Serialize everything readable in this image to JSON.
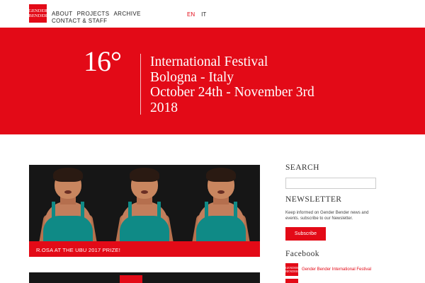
{
  "logo": {
    "line1": "GENDER",
    "line2": "BENDER"
  },
  "nav": {
    "items": [
      "ABOUT",
      "PROJECTS",
      "ARCHIVE",
      "CONTACT & STAFF"
    ]
  },
  "lang": {
    "active": "EN",
    "inactive": "IT"
  },
  "hero": {
    "edition": "16°",
    "line1": "International Festival",
    "line2": "Bologna - Italy",
    "line3": "October 24th - November 3rd",
    "line4": "2018"
  },
  "feature": {
    "caption": "R.OSA AT THE UBU 2017 PRIZE!"
  },
  "sidebar": {
    "search_heading": "SEARCH",
    "newsletter_heading": "NEWSLETTER",
    "newsletter_text": "Keep informed on Gender Bender news and events. subscribe to our Newsletter.",
    "subscribe_label": "Subscribe",
    "facebook_heading": "Facebook",
    "facebook_page": "Gender Bender International Festival"
  },
  "colors": {
    "brand_red": "#e30a17",
    "dark": "#161616",
    "swimsuit": "#0f8a86"
  }
}
